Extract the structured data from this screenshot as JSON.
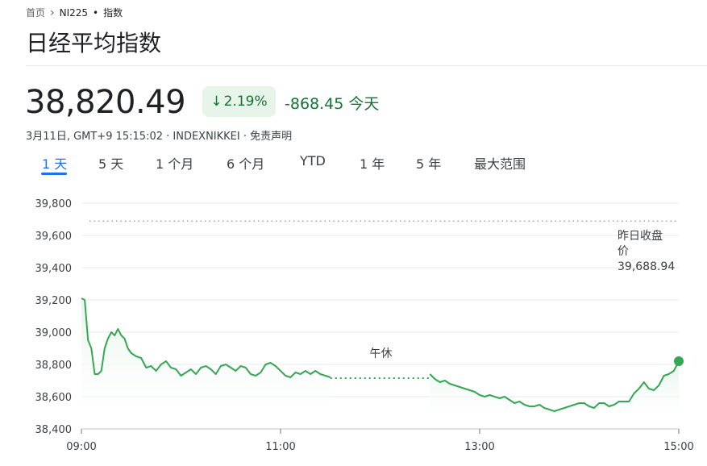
{
  "breadcrumb": {
    "home": "首页",
    "symbol": "NI225",
    "sep": "•",
    "type": "指数"
  },
  "title": "日经平均指数",
  "quote": {
    "price": "38,820.49",
    "change_pct": "2.19%",
    "change_abs": "-868.45",
    "period": "今天",
    "meta": "3月11日, GMT+9 15:15:02 · INDEXNIKKEI · 免责声明"
  },
  "ranges": [
    "1 天",
    "5 天",
    "1 个月",
    "6 个月",
    "YTD",
    "1 年",
    "5 年",
    "最大范围"
  ],
  "active_range": "1 天",
  "colors": {
    "line": "#34a853",
    "fill": "#e6f4ea",
    "text_green": "#137333",
    "active_tab": "#1a73e8",
    "grid": "#e8eaed",
    "ref_line": "#9aa0a6"
  },
  "chart_data": {
    "type": "line",
    "ylim": [
      38400,
      39800
    ],
    "yticks": [
      "39,800",
      "39,600",
      "39,400",
      "39,200",
      "39,000",
      "38,800",
      "38,600",
      "38,400"
    ],
    "xticks": [
      "09:00",
      "11:00",
      "13:00",
      "15:00"
    ],
    "reference": {
      "label_line1": "昨日收盘",
      "label_line2": "价",
      "value_text": "39,688.94",
      "value": 39688.94
    },
    "lunch_label": "午休",
    "morning": {
      "x": [
        "09:00",
        "09:02",
        "09:04",
        "09:06",
        "09:08",
        "09:10",
        "09:12",
        "09:14",
        "09:16",
        "09:18",
        "09:20",
        "09:22",
        "09:24",
        "09:26",
        "09:28",
        "09:30",
        "09:33",
        "09:36",
        "09:39",
        "09:42",
        "09:45",
        "09:48",
        "09:51",
        "09:54",
        "09:57",
        "10:00",
        "10:03",
        "10:06",
        "10:09",
        "10:12",
        "10:15",
        "10:18",
        "10:21",
        "10:24",
        "10:27",
        "10:30",
        "10:33",
        "10:36",
        "10:39",
        "10:42",
        "10:45",
        "10:48",
        "10:51",
        "10:54",
        "10:57",
        "11:00",
        "11:03",
        "11:06",
        "11:09",
        "11:12",
        "11:15",
        "11:18",
        "11:21",
        "11:24",
        "11:27",
        "11:30"
      ],
      "y": [
        39210,
        39200,
        38950,
        38900,
        38740,
        38740,
        38760,
        38900,
        38960,
        39000,
        38980,
        39020,
        38980,
        38960,
        38900,
        38870,
        38850,
        38840,
        38780,
        38790,
        38760,
        38800,
        38820,
        38780,
        38770,
        38730,
        38750,
        38770,
        38740,
        38780,
        38790,
        38770,
        38740,
        38790,
        38800,
        38780,
        38760,
        38790,
        38780,
        38740,
        38730,
        38750,
        38800,
        38810,
        38790,
        38760,
        38730,
        38720,
        38750,
        38740,
        38760,
        38740,
        38760,
        38740,
        38730,
        38720
      ]
    },
    "afternoon": {
      "x": [
        "12:30",
        "12:33",
        "12:36",
        "12:39",
        "12:42",
        "12:45",
        "12:48",
        "12:51",
        "12:54",
        "12:57",
        "13:00",
        "13:03",
        "13:06",
        "13:09",
        "13:12",
        "13:15",
        "13:18",
        "13:21",
        "13:24",
        "13:27",
        "13:30",
        "13:33",
        "13:36",
        "13:39",
        "13:42",
        "13:45",
        "13:48",
        "13:51",
        "13:54",
        "13:57",
        "14:00",
        "14:03",
        "14:06",
        "14:09",
        "14:12",
        "14:15",
        "14:18",
        "14:21",
        "14:24",
        "14:27",
        "14:30",
        "14:33",
        "14:36",
        "14:39",
        "14:42",
        "14:45",
        "14:48",
        "14:51",
        "14:54",
        "14:57",
        "15:00"
      ],
      "y": [
        38740,
        38710,
        38690,
        38700,
        38680,
        38670,
        38660,
        38650,
        38640,
        38630,
        38610,
        38600,
        38610,
        38600,
        38590,
        38600,
        38580,
        38560,
        38570,
        38550,
        38540,
        38540,
        38550,
        38530,
        38520,
        38510,
        38520,
        38530,
        38540,
        38550,
        38560,
        38560,
        38540,
        38530,
        38560,
        38560,
        38540,
        38550,
        38570,
        38570,
        38570,
        38620,
        38650,
        38690,
        38650,
        38640,
        38670,
        38730,
        38740,
        38760,
        38820
      ]
    }
  }
}
